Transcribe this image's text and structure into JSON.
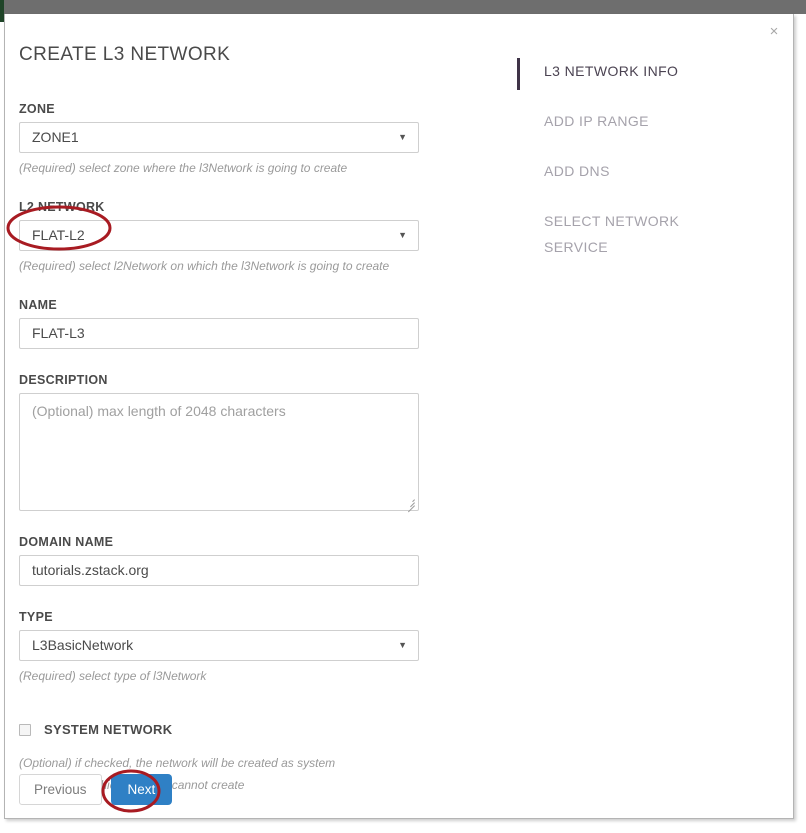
{
  "dialog": {
    "title": "CREATE L3 NETWORK",
    "close_label": "×"
  },
  "form": {
    "zone": {
      "label": "ZONE",
      "value": "ZONE1",
      "hint": "(Required) select zone where the l3Network is going to create",
      "caret": "▼"
    },
    "l2_network": {
      "label": "L2 NETWORK",
      "value": "FLAT-L2",
      "hint": "(Required) select l2Network on which the l3Network is going to create",
      "caret": "▼"
    },
    "name": {
      "label": "NAME",
      "value": "FLAT-L3"
    },
    "description": {
      "label": "DESCRIPTION",
      "placeholder": "(Optional) max length of 2048 characters",
      "value": ""
    },
    "domain_name": {
      "label": "DOMAIN NAME",
      "value": "tutorials.zstack.org"
    },
    "type": {
      "label": "TYPE",
      "value": "L3BasicNetwork",
      "hint": "(Required) select type of l3Network",
      "caret": "▼"
    },
    "system_network": {
      "label": "SYSTEM NETWORK",
      "checked": false,
      "hint_line1": "(Optional) if checked, the network will be created as system",
      "hint_line2": "network from which user vm cannot create"
    }
  },
  "buttons": {
    "previous": "Previous",
    "next": "Next"
  },
  "steps": [
    {
      "label": "L3 NETWORK INFO",
      "active": true
    },
    {
      "label": "ADD IP RANGE",
      "active": false
    },
    {
      "label": "ADD DNS",
      "active": false
    },
    {
      "label": "SELECT NETWORK SERVICE",
      "active": false
    }
  ],
  "annotations": {
    "color": "#a81b22",
    "l2_highlight": "ellipse-around-l2-network-value",
    "next_highlight": "ellipse-around-next-button"
  }
}
